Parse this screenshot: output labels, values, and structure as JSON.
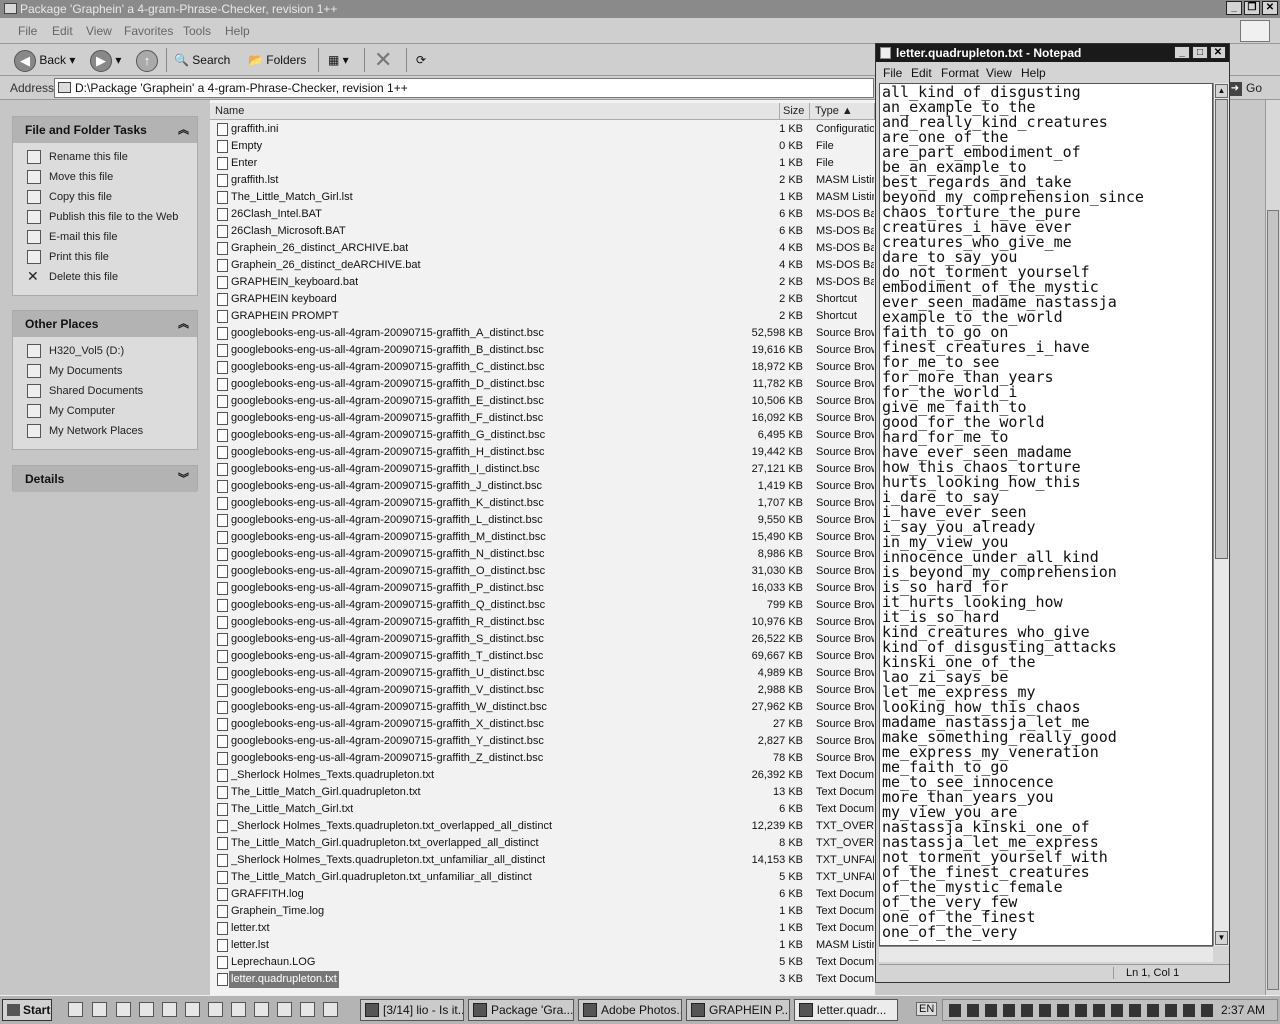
{
  "explorer": {
    "title": "Package 'Graphein' a 4-gram-Phrase-Checker, revision 1++",
    "menu": [
      "File",
      "Edit",
      "View",
      "Favorites",
      "Tools",
      "Help"
    ],
    "toolbar": {
      "back": "Back",
      "search": "Search",
      "folders": "Folders"
    },
    "address_label": "Address",
    "address_value": "D:\\Package 'Graphein' a 4-gram-Phrase-Checker, revision 1++",
    "go_label": "Go",
    "tasks": {
      "title": "File and Folder Tasks",
      "items": [
        "Rename this file",
        "Move this file",
        "Copy this file",
        "Publish this file to the Web",
        "E-mail this file",
        "Print this file",
        "Delete this file"
      ]
    },
    "places": {
      "title": "Other Places",
      "items": [
        "H320_Vol5 (D:)",
        "My Documents",
        "Shared Documents",
        "My Computer",
        "My Network Places"
      ]
    },
    "details": {
      "title": "Details"
    },
    "columns": {
      "name": "Name",
      "size": "Size",
      "type": "Type"
    },
    "files": [
      {
        "name": "graffith.ini",
        "size": "1 KB",
        "type": "Configuration"
      },
      {
        "name": "Empty",
        "size": "0 KB",
        "type": "File"
      },
      {
        "name": "Enter",
        "size": "1 KB",
        "type": "File"
      },
      {
        "name": "graffith.lst",
        "size": "2 KB",
        "type": "MASM Listing"
      },
      {
        "name": "The_Little_Match_Girl.lst",
        "size": "1 KB",
        "type": "MASM Listing"
      },
      {
        "name": "26Clash_Intel.BAT",
        "size": "6 KB",
        "type": "MS-DOS Batch"
      },
      {
        "name": "26Clash_Microsoft.BAT",
        "size": "6 KB",
        "type": "MS-DOS Batch"
      },
      {
        "name": "Graphein_26_distinct_ARCHIVE.bat",
        "size": "4 KB",
        "type": "MS-DOS Batch"
      },
      {
        "name": "Graphein_26_distinct_deARCHIVE.bat",
        "size": "4 KB",
        "type": "MS-DOS Batch"
      },
      {
        "name": "GRAPHEIN_keyboard.bat",
        "size": "2 KB",
        "type": "MS-DOS Batch"
      },
      {
        "name": "GRAPHEIN keyboard",
        "size": "2 KB",
        "type": "Shortcut"
      },
      {
        "name": "GRAPHEIN PROMPT",
        "size": "2 KB",
        "type": "Shortcut"
      },
      {
        "name": "googlebooks-eng-us-all-4gram-20090715-graffith_A_distinct.bsc",
        "size": "52,598 KB",
        "type": "Source Browser"
      },
      {
        "name": "googlebooks-eng-us-all-4gram-20090715-graffith_B_distinct.bsc",
        "size": "19,616 KB",
        "type": "Source Browser"
      },
      {
        "name": "googlebooks-eng-us-all-4gram-20090715-graffith_C_distinct.bsc",
        "size": "18,972 KB",
        "type": "Source Browser"
      },
      {
        "name": "googlebooks-eng-us-all-4gram-20090715-graffith_D_distinct.bsc",
        "size": "11,782 KB",
        "type": "Source Browser"
      },
      {
        "name": "googlebooks-eng-us-all-4gram-20090715-graffith_E_distinct.bsc",
        "size": "10,506 KB",
        "type": "Source Browser"
      },
      {
        "name": "googlebooks-eng-us-all-4gram-20090715-graffith_F_distinct.bsc",
        "size": "16,092 KB",
        "type": "Source Browser"
      },
      {
        "name": "googlebooks-eng-us-all-4gram-20090715-graffith_G_distinct.bsc",
        "size": "6,495 KB",
        "type": "Source Browser"
      },
      {
        "name": "googlebooks-eng-us-all-4gram-20090715-graffith_H_distinct.bsc",
        "size": "19,442 KB",
        "type": "Source Browser"
      },
      {
        "name": "googlebooks-eng-us-all-4gram-20090715-graffith_I_distinct.bsc",
        "size": "27,121 KB",
        "type": "Source Browser"
      },
      {
        "name": "googlebooks-eng-us-all-4gram-20090715-graffith_J_distinct.bsc",
        "size": "1,419 KB",
        "type": "Source Browser"
      },
      {
        "name": "googlebooks-eng-us-all-4gram-20090715-graffith_K_distinct.bsc",
        "size": "1,707 KB",
        "type": "Source Browser"
      },
      {
        "name": "googlebooks-eng-us-all-4gram-20090715-graffith_L_distinct.bsc",
        "size": "9,550 KB",
        "type": "Source Browser"
      },
      {
        "name": "googlebooks-eng-us-all-4gram-20090715-graffith_M_distinct.bsc",
        "size": "15,490 KB",
        "type": "Source Browser"
      },
      {
        "name": "googlebooks-eng-us-all-4gram-20090715-graffith_N_distinct.bsc",
        "size": "8,986 KB",
        "type": "Source Browser"
      },
      {
        "name": "googlebooks-eng-us-all-4gram-20090715-graffith_O_distinct.bsc",
        "size": "31,030 KB",
        "type": "Source Browser"
      },
      {
        "name": "googlebooks-eng-us-all-4gram-20090715-graffith_P_distinct.bsc",
        "size": "16,033 KB",
        "type": "Source Browser"
      },
      {
        "name": "googlebooks-eng-us-all-4gram-20090715-graffith_Q_distinct.bsc",
        "size": "799 KB",
        "type": "Source Browser"
      },
      {
        "name": "googlebooks-eng-us-all-4gram-20090715-graffith_R_distinct.bsc",
        "size": "10,976 KB",
        "type": "Source Browser"
      },
      {
        "name": "googlebooks-eng-us-all-4gram-20090715-graffith_S_distinct.bsc",
        "size": "26,522 KB",
        "type": "Source Browser"
      },
      {
        "name": "googlebooks-eng-us-all-4gram-20090715-graffith_T_distinct.bsc",
        "size": "69,667 KB",
        "type": "Source Browser"
      },
      {
        "name": "googlebooks-eng-us-all-4gram-20090715-graffith_U_distinct.bsc",
        "size": "4,989 KB",
        "type": "Source Browser"
      },
      {
        "name": "googlebooks-eng-us-all-4gram-20090715-graffith_V_distinct.bsc",
        "size": "2,988 KB",
        "type": "Source Browser"
      },
      {
        "name": "googlebooks-eng-us-all-4gram-20090715-graffith_W_distinct.bsc",
        "size": "27,962 KB",
        "type": "Source Browser"
      },
      {
        "name": "googlebooks-eng-us-all-4gram-20090715-graffith_X_distinct.bsc",
        "size": "27 KB",
        "type": "Source Browser"
      },
      {
        "name": "googlebooks-eng-us-all-4gram-20090715-graffith_Y_distinct.bsc",
        "size": "2,827 KB",
        "type": "Source Browser"
      },
      {
        "name": "googlebooks-eng-us-all-4gram-20090715-graffith_Z_distinct.bsc",
        "size": "78 KB",
        "type": "Source Browser"
      },
      {
        "name": "_Sherlock Holmes_Texts.quadrupleton.txt",
        "size": "26,392 KB",
        "type": "Text Document"
      },
      {
        "name": "The_Little_Match_Girl.quadrupleton.txt",
        "size": "13 KB",
        "type": "Text Document"
      },
      {
        "name": "The_Little_Match_Girl.txt",
        "size": "6 KB",
        "type": "Text Document"
      },
      {
        "name": "_Sherlock Holmes_Texts.quadrupleton.txt_overlapped_all_distinct",
        "size": "12,239 KB",
        "type": "TXT_OVERLAPPED"
      },
      {
        "name": "The_Little_Match_Girl.quadrupleton.txt_overlapped_all_distinct",
        "size": "8 KB",
        "type": "TXT_OVERLAPPED"
      },
      {
        "name": "_Sherlock Holmes_Texts.quadrupleton.txt_unfamiliar_all_distinct",
        "size": "14,153 KB",
        "type": "TXT_UNFAMILIAR"
      },
      {
        "name": "The_Little_Match_Girl.quadrupleton.txt_unfamiliar_all_distinct",
        "size": "5 KB",
        "type": "TXT_UNFAMILIAR"
      },
      {
        "name": "GRAFFITH.log",
        "size": "6 KB",
        "type": "Text Document"
      },
      {
        "name": "Graphein_Time.log",
        "size": "1 KB",
        "type": "Text Document"
      },
      {
        "name": "letter.txt",
        "size": "1 KB",
        "type": "Text Document"
      },
      {
        "name": "letter.lst",
        "size": "1 KB",
        "type": "MASM Listing"
      },
      {
        "name": "Leprechaun.LOG",
        "size": "5 KB",
        "type": "Text Document"
      },
      {
        "name": "letter.quadrupleton.txt",
        "size": "3 KB",
        "type": "Text Document",
        "selected": true
      }
    ]
  },
  "notepad": {
    "title": "letter.quadrupleton.txt - Notepad",
    "menu": [
      "File",
      "Edit",
      "Format",
      "View",
      "Help"
    ],
    "lines": [
      "all_kind_of_disgusting",
      "an_example_to_the",
      "and_really_kind_creatures",
      "are_one_of_the",
      "are_part_embodiment_of",
      "be_an_example_to",
      "best_regards_and_take",
      "beyond_my_comprehension_since",
      "chaos_torture_the_pure",
      "creatures_i_have_ever",
      "creatures_who_give_me",
      "dare_to_say_you",
      "do_not_torment_yourself",
      "embodiment_of_the_mystic",
      "ever_seen_madame_nastassja",
      "example_to_the_world",
      "faith_to_go_on",
      "finest_creatures_i_have",
      "for_me_to_see",
      "for_more_than_years",
      "for_the_world_i",
      "give_me_faith_to",
      "good_for_the_world",
      "hard_for_me_to",
      "have_ever_seen_madame",
      "how_this_chaos_torture",
      "hurts_looking_how_this",
      "i_dare_to_say",
      "i_have_ever_seen",
      "i_say_you_already",
      "in_my_view_you",
      "innocence_under_all_kind",
      "is_beyond_my_comprehension",
      "is_so_hard_for",
      "it_hurts_looking_how",
      "it_is_so_hard",
      "kind_creatures_who_give",
      "kind_of_disgusting_attacks",
      "kinski_one_of_the",
      "lao_zi_says_be",
      "let_me_express_my",
      "looking_how_this_chaos",
      "madame_nastassja_let_me",
      "make_something_really_good",
      "me_express_my_veneration",
      "me_faith_to_go",
      "me_to_see_innocence",
      "more_than_years_you",
      "my_view_you_are",
      "nastassja_kinski_one_of",
      "nastassja_let_me_express",
      "not_torment_yourself_with",
      "of_the_finest_creatures",
      "of_the_mystic_female",
      "of_the_very_few",
      "one_of_the_finest",
      "one_of_the_very"
    ],
    "status": "Ln 1, Col 1"
  },
  "taskbar": {
    "start": "Start",
    "tasks": [
      "[3/14] lio - Is it...",
      "Package 'Gra...",
      "Adobe Photos...",
      "GRAPHEIN P...",
      "letter.quadr..."
    ],
    "lang": "EN",
    "clock": "2:37 AM"
  }
}
